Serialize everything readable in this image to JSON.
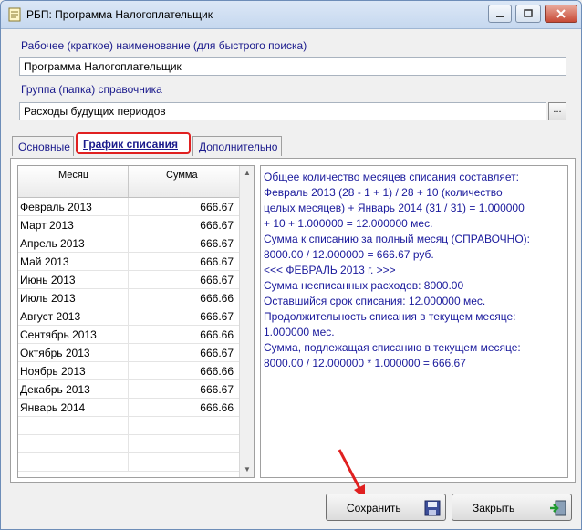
{
  "window": {
    "title": "РБП: Программа Налогоплательщик"
  },
  "form": {
    "name_label": "Рабочее (краткое) наименование (для быстрого поиска)",
    "name_value": "Программа Налогоплательщик",
    "group_label": "Группа (папка) справочника",
    "group_value": "Расходы будущих периодов",
    "group_button": "..."
  },
  "tabs": [
    {
      "label": "Основные"
    },
    {
      "label": "График списания",
      "active": true
    },
    {
      "label": "Дополнительно"
    }
  ],
  "grid": {
    "headers": {
      "month": "Месяц",
      "sum": "Сумма"
    },
    "rows": [
      {
        "month": "Февраль 2013",
        "sum": "666.67"
      },
      {
        "month": "Март 2013",
        "sum": "666.67"
      },
      {
        "month": "Апрель 2013",
        "sum": "666.67"
      },
      {
        "month": "Май 2013",
        "sum": "666.67"
      },
      {
        "month": "Июнь 2013",
        "sum": "666.67"
      },
      {
        "month": "Июль 2013",
        "sum": "666.66"
      },
      {
        "month": "Август 2013",
        "sum": "666.67"
      },
      {
        "month": "Сентябрь 2013",
        "sum": "666.66"
      },
      {
        "month": "Октябрь 2013",
        "sum": "666.67"
      },
      {
        "month": "Ноябрь 2013",
        "sum": "666.66"
      },
      {
        "month": "Декабрь 2013",
        "sum": "666.67"
      },
      {
        "month": "Январь 2014",
        "sum": "666.66"
      }
    ]
  },
  "info": {
    "lines": [
      "Общее количество месяцев списания составляет:",
      "Февраль 2013 (28 - 1 + 1) / 28 + 10 (количество",
      "целых месяцев) + Январь 2014 (31 / 31) = 1.000000",
      "+ 10 + 1.000000 = 12.000000 мес.",
      "Сумма к списанию за полный месяц (СПРАВОЧНО):",
      "8000.00 / 12.000000 = 666.67 руб.",
      "<<< ФЕВРАЛЬ 2013 г. >>>",
      "Сумма несписанных расходов: 8000.00",
      "Оставшийся срок списания: 12.000000 мес.",
      "Продолжительность списания в текущем месяце:",
      "1.000000 мес.",
      "Сумма, подлежащая списанию в текущем месяце:",
      "8000.00 / 12.000000 * 1.000000 = 666.67"
    ]
  },
  "buttons": {
    "save": "Сохранить",
    "close": "Закрыть"
  },
  "colors": {
    "label_text": "#1a1a8c",
    "info_text": "#1a1a9c",
    "highlight_red": "#e02020"
  }
}
